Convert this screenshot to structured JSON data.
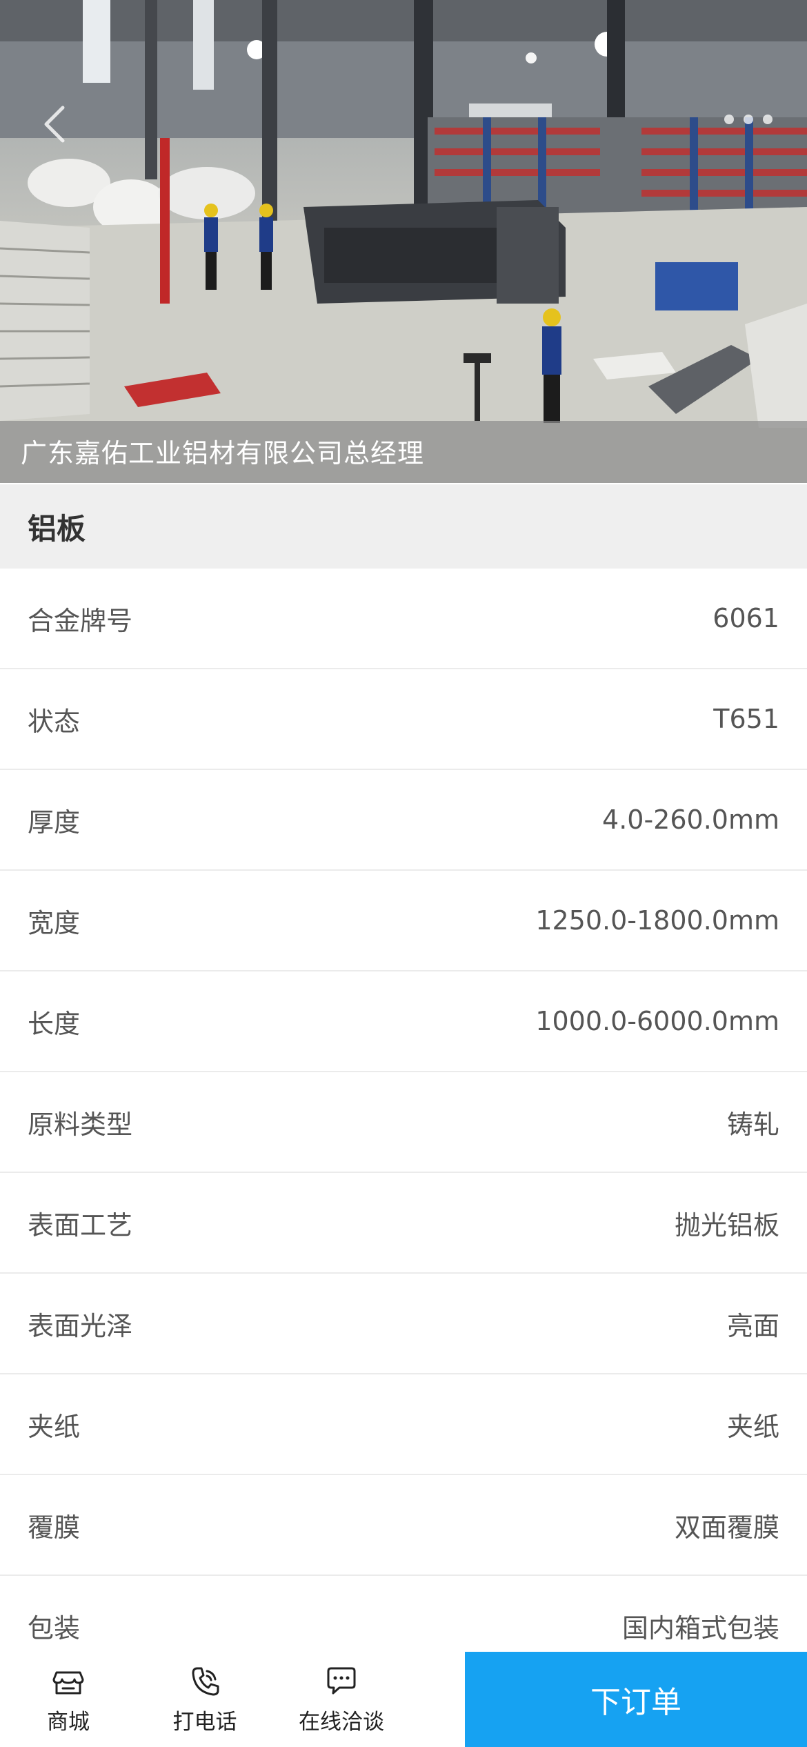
{
  "hero": {
    "caption": "广东嘉佑工业铝材有限公司总经理",
    "back_icon": "chevron-left-icon",
    "slide_count": 3
  },
  "section": {
    "title": "铝板"
  },
  "specs": [
    {
      "label": "合金牌号",
      "value": "6061"
    },
    {
      "label": "状态",
      "value": "T651"
    },
    {
      "label": "厚度",
      "value": "4.0-260.0mm"
    },
    {
      "label": "宽度",
      "value": "1250.0-1800.0mm"
    },
    {
      "label": "长度",
      "value": "1000.0-6000.0mm"
    },
    {
      "label": "原料类型",
      "value": "铸轧"
    },
    {
      "label": "表面工艺",
      "value": "抛光铝板"
    },
    {
      "label": "表面光泽",
      "value": "亮面"
    },
    {
      "label": "夹纸",
      "value": "夹纸"
    },
    {
      "label": "覆膜",
      "value": "双面覆膜"
    },
    {
      "label": "包装",
      "value": "国内箱式包装"
    }
  ],
  "bottom_bar": {
    "tabs": [
      {
        "label": "商城",
        "icon": "store-icon"
      },
      {
        "label": "打电话",
        "icon": "phone-icon"
      },
      {
        "label": "在线洽谈",
        "icon": "chat-icon"
      }
    ],
    "order_label": "下订单",
    "accent_color": "#16a2f2"
  }
}
